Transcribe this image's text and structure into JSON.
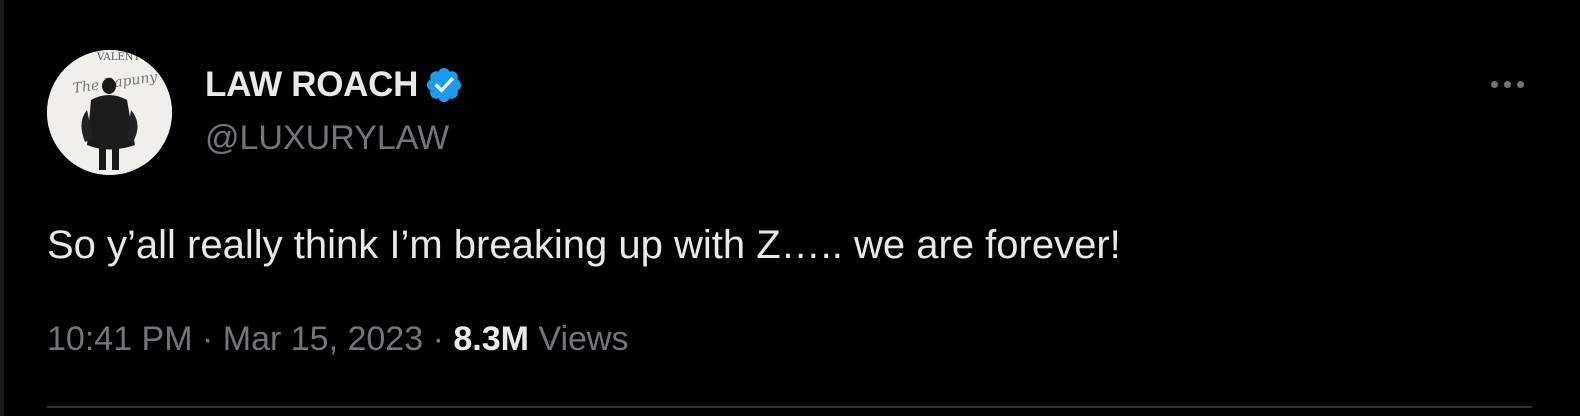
{
  "tweet": {
    "author": {
      "display_name": "LAW ROACH",
      "handle": "@LUXURYLAW",
      "verified_icon": "verified-badge-icon",
      "avatar_backdrop_text": [
        "VALENT",
        "The Rapuny"
      ]
    },
    "more_icon": "more-options-icon",
    "text": "So y’all really think I’m breaking up with Z….. we are forever!",
    "time": "10:41 PM",
    "separator": "·",
    "date": "Mar 15, 2023",
    "views_count": "8.3M",
    "views_label": "Views"
  },
  "colors": {
    "background": "#000000",
    "primary_text": "#e7e9ea",
    "secondary_text": "#71767b",
    "verified_blue": "#1d9bf0",
    "divider": "#2f3336"
  }
}
